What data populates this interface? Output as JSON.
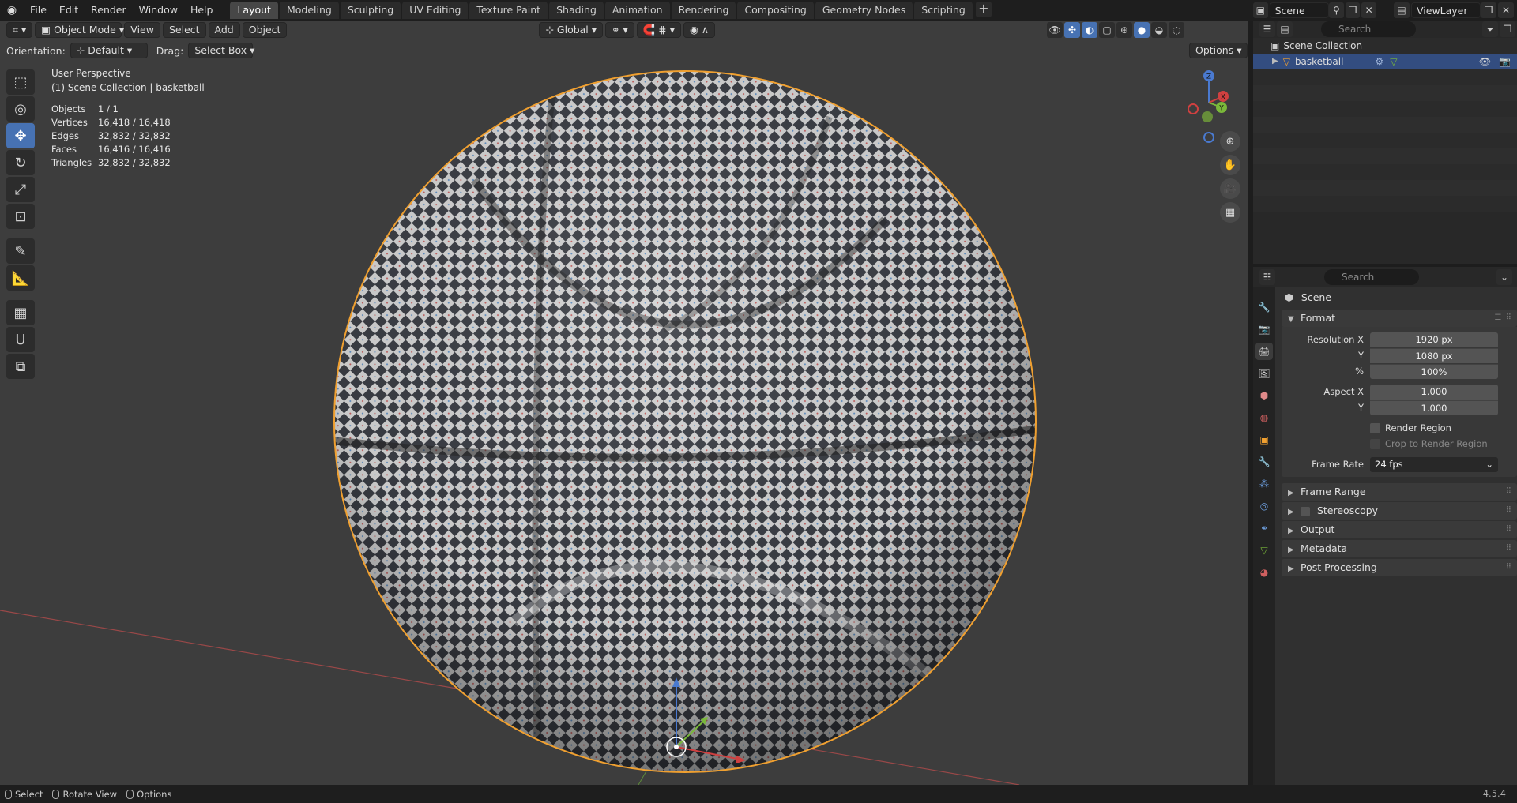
{
  "topbar": {
    "menus": [
      "File",
      "Edit",
      "Render",
      "Window",
      "Help"
    ],
    "workspaces": [
      "Layout",
      "Modeling",
      "Sculpting",
      "UV Editing",
      "Texture Paint",
      "Shading",
      "Animation",
      "Rendering",
      "Compositing",
      "Geometry Nodes",
      "Scripting"
    ],
    "active_workspace": "Layout",
    "scene": "Scene",
    "view_layer": "ViewLayer"
  },
  "viewport": {
    "mode": "Object Mode",
    "menus": [
      "View",
      "Select",
      "Add",
      "Object"
    ],
    "transform_orientation": "Global",
    "orientation_label": "Orientation:",
    "orientation_value": "Default",
    "drag_label": "Drag:",
    "drag_value": "Select Box",
    "options_label": "Options",
    "perspective": "User Perspective",
    "collection_path": "(1) Scene Collection | basketball",
    "stats": [
      {
        "label": "Objects",
        "value": "1 / 1"
      },
      {
        "label": "Vertices",
        "value": "16,418 / 16,418"
      },
      {
        "label": "Edges",
        "value": "32,832 / 32,832"
      },
      {
        "label": "Faces",
        "value": "16,416 / 16,416"
      },
      {
        "label": "Triangles",
        "value": "32,832 / 32,832"
      }
    ],
    "gizmo_axes": {
      "z": "Z",
      "y": "Y",
      "x": "X"
    }
  },
  "outliner": {
    "search_placeholder": "Search",
    "root": "Scene Collection",
    "object": "basketball"
  },
  "properties": {
    "search_placeholder": "Search",
    "context": "Scene",
    "format_title": "Format",
    "rows": {
      "res_x_label": "Resolution X",
      "res_x": "1920 px",
      "res_y_label": "Y",
      "res_y": "1080 px",
      "res_pct_label": "%",
      "res_pct": "100%",
      "aspect_x_label": "Aspect X",
      "aspect_x": "1.000",
      "aspect_y_label": "Y",
      "aspect_y": "1.000",
      "render_region": "Render Region",
      "crop_region": "Crop to Render Region",
      "frame_rate_label": "Frame Rate",
      "frame_rate": "24 fps"
    },
    "panels": [
      "Frame Range",
      "Stereoscopy",
      "Output",
      "Metadata",
      "Post Processing"
    ]
  },
  "statusbar": {
    "select": "Select",
    "rotate": "Rotate View",
    "options": "Options",
    "version": "4.5.4"
  },
  "colors": {
    "accent": "#4772b3",
    "selection_outline": "#f0a030",
    "viewport_bg": "#3d3d3d"
  }
}
